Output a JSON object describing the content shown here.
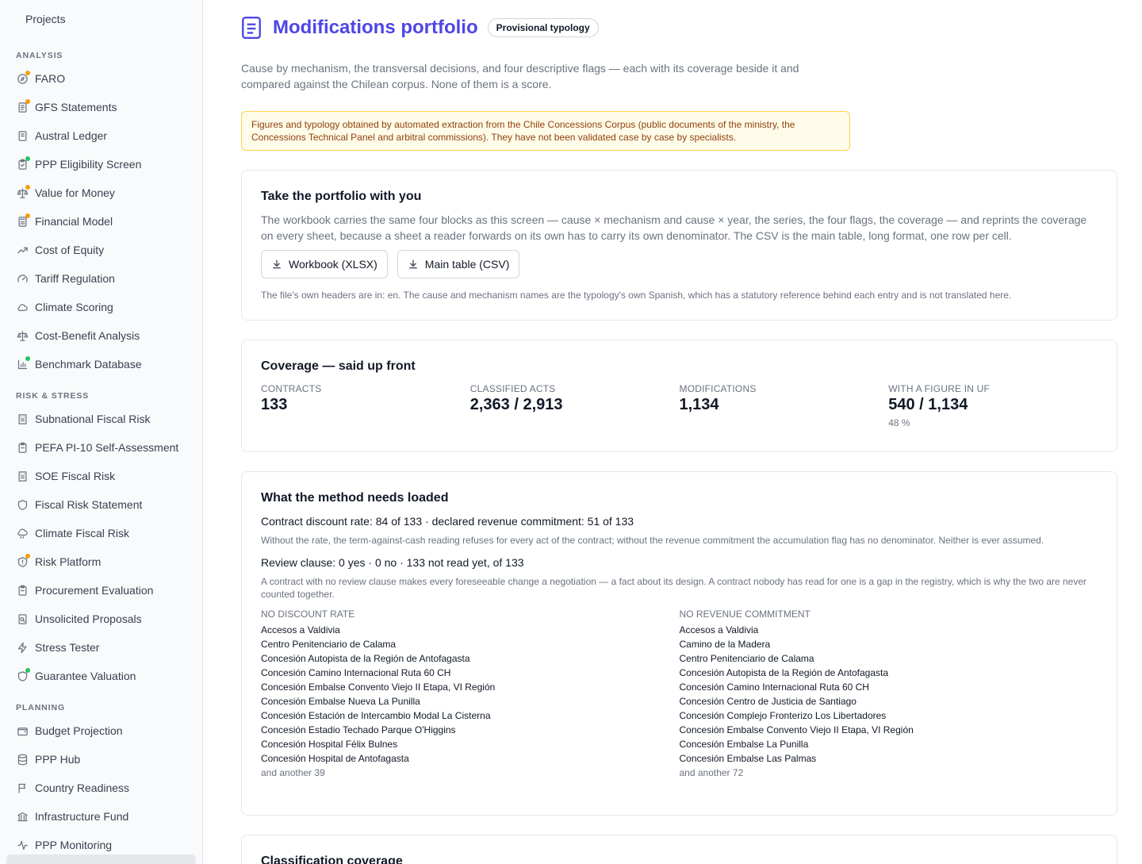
{
  "sidebar": {
    "top_item": {
      "label": "Projects",
      "icon": "folder-icon"
    },
    "sections": [
      {
        "label": "ANALYSIS",
        "items": [
          {
            "label": "FARO",
            "icon": "compass-icon",
            "dot": "orange"
          },
          {
            "label": "GFS Statements",
            "icon": "document-icon",
            "dot": "orange"
          },
          {
            "label": "Austral Ledger",
            "icon": "ledger-icon",
            "dot": ""
          },
          {
            "label": "PPP Eligibility Screen",
            "icon": "clipboard-check-icon",
            "dot": "green"
          },
          {
            "label": "Value for Money",
            "icon": "scale-icon",
            "dot": "orange"
          },
          {
            "label": "Financial Model",
            "icon": "calculator-icon",
            "dot": "orange"
          },
          {
            "label": "Cost of Equity",
            "icon": "trending-up-icon",
            "dot": ""
          },
          {
            "label": "Tariff Regulation",
            "icon": "gauge-icon",
            "dot": ""
          },
          {
            "label": "Climate Scoring",
            "icon": "cloud-icon",
            "dot": ""
          },
          {
            "label": "Cost-Benefit Analysis",
            "icon": "scale-icon",
            "dot": ""
          },
          {
            "label": "Benchmark Database",
            "icon": "bar-chart-icon",
            "dot": "green"
          }
        ]
      },
      {
        "label": "RISK & STRESS",
        "items": [
          {
            "label": "Subnational Fiscal Risk",
            "icon": "building-icon",
            "dot": ""
          },
          {
            "label": "PEFA PI-10 Self-Assessment",
            "icon": "clipboard-icon",
            "dot": ""
          },
          {
            "label": "SOE Fiscal Risk",
            "icon": "building-icon",
            "dot": ""
          },
          {
            "label": "Fiscal Risk Statement",
            "icon": "shield-icon",
            "dot": ""
          },
          {
            "label": "Climate Fiscal Risk",
            "icon": "cloud-rain-icon",
            "dot": ""
          },
          {
            "label": "Risk Platform",
            "icon": "shield-alert-icon",
            "dot": "orange"
          },
          {
            "label": "Procurement Evaluation",
            "icon": "clipboard-icon",
            "dot": ""
          },
          {
            "label": "Unsolicited Proposals",
            "icon": "file-search-icon",
            "dot": ""
          },
          {
            "label": "Stress Tester",
            "icon": "zap-icon",
            "dot": ""
          },
          {
            "label": "Guarantee Valuation",
            "icon": "shield-icon",
            "dot": "green"
          }
        ]
      },
      {
        "label": "PLANNING",
        "items": [
          {
            "label": "Budget Projection",
            "icon": "wallet-icon",
            "dot": ""
          },
          {
            "label": "PPP Hub",
            "icon": "database-icon",
            "dot": ""
          },
          {
            "label": "Country Readiness",
            "icon": "flag-icon",
            "dot": ""
          },
          {
            "label": "Infrastructure Fund",
            "icon": "landmark-icon",
            "dot": ""
          },
          {
            "label": "PPP Monitoring",
            "icon": "activity-icon",
            "dot": ""
          }
        ]
      }
    ]
  },
  "header": {
    "title": "Modifications portfolio",
    "badge": "Provisional typology",
    "icon": "book-icon"
  },
  "intro": "Cause by mechanism, the transversal decisions, and four descriptive flags — each with its coverage beside it and compared against the Chilean corpus. None of them is a score.",
  "notice": "Figures and typology obtained by automated extraction from the Chile Concessions Corpus (public documents of the ministry, the Concessions Technical Panel and arbitral commissions). They have not been validated case by case by specialists.",
  "export": {
    "title": "Take the portfolio with you",
    "lead": "The workbook carries the same four blocks as this screen — cause × mechanism and cause × year, the series, the four flags, the coverage — and reprints the coverage on every sheet, because a sheet a reader forwards on its own has to carry its own denominator. The CSV is the main table, long format, one row per cell.",
    "xlsx_label": "Workbook (XLSX)",
    "csv_label": "Main table (CSV)",
    "note": "The file's own headers are in: en. The cause and mechanism names are the typology's own Spanish, which has a statutory reference behind each entry and is not translated here."
  },
  "coverage": {
    "title": "Coverage — said up front",
    "stats": [
      {
        "label": "CONTRACTS",
        "value": "133",
        "sub": ""
      },
      {
        "label": "CLASSIFIED ACTS",
        "value": "2,363 / 2,913",
        "sub": ""
      },
      {
        "label": "MODIFICATIONS",
        "value": "1,134",
        "sub": ""
      },
      {
        "label": "WITH A FIGURE IN UF",
        "value": "540 / 1,134",
        "sub": "48 %"
      }
    ]
  },
  "method": {
    "title": "What the method needs loaded",
    "line1": "Contract discount rate: 84 of 133 · declared revenue commitment: 51 of 133",
    "explain1": "Without the rate, the term-against-cash reading refuses for every act of the contract; without the revenue commitment the accumulation flag has no denominator. Neither is ever assumed.",
    "line2": "Review clause: 0 yes · 0 no · 133 not read yet, of 133",
    "explain2": "A contract with no review clause makes every foreseeable change a negotiation — a fact about its design. A contract nobody has read for one is a gap in the registry, which is why the two are never counted together.",
    "no_discount": {
      "header": "NO DISCOUNT RATE",
      "items": [
        "Accesos a Valdivia",
        "Centro Penitenciario de Calama",
        "Concesión Autopista de la Región de Antofagasta",
        "Concesión Camino Internacional Ruta 60 CH",
        "Concesión Embalse Convento Viejo II Etapa, VI Región",
        "Concesión Embalse Nueva La Punilla",
        "Concesión Estación de Intercambio Modal La Cisterna",
        "Concesión Estadio Techado Parque O'Higgins",
        "Concesión Hospital Félix Bulnes",
        "Concesión Hospital de Antofagasta"
      ],
      "more": "and another 39"
    },
    "no_revenue": {
      "header": "NO REVENUE COMMITMENT",
      "items": [
        "Accesos a Valdivia",
        "Camino de la Madera",
        "Centro Penitenciario de Calama",
        "Concesión Autopista de la Región de Antofagasta",
        "Concesión Camino Internacional Ruta 60 CH",
        "Concesión Centro de Justicia de Santiago",
        "Concesión Complejo Fronterizo Los Libertadores",
        "Concesión Embalse Convento Viejo II Etapa, VI Región",
        "Concesión Embalse La Punilla",
        "Concesión Embalse Las Palmas"
      ],
      "more": "and another 72"
    }
  },
  "classification": {
    "title": "Classification coverage"
  }
}
